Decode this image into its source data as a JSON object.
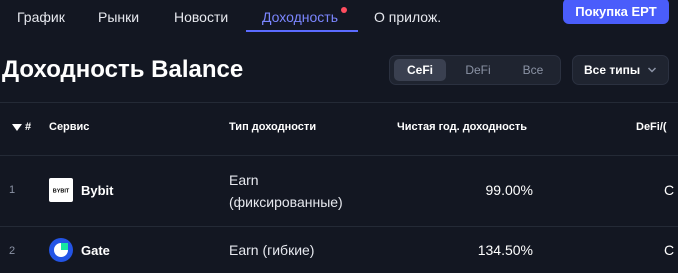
{
  "nav": {
    "items": [
      "График",
      "Рынки",
      "Новости",
      "Доходность",
      "О прилож."
    ],
    "active_index": 3,
    "buy_button": "Покупка EPT"
  },
  "page_title": "Доходность Balance",
  "segment": {
    "options": [
      "CeFi",
      "DeFi",
      "Все"
    ],
    "selected": "CeFi"
  },
  "type_filter": {
    "label": "Все типы",
    "icon": "chevron-down-icon"
  },
  "table": {
    "columns": [
      "#",
      "Сервис",
      "Тип доходности",
      "Чистая год. доходность",
      "DeFi/("
    ],
    "sort_icon": "sort-down-icon",
    "rows": [
      {
        "num": "1",
        "service": "Bybit",
        "logo_text": "BYBIT",
        "yield_type_line1": "Earn",
        "yield_type_line2": "(фиксированные)",
        "yield": "99.00%",
        "cut": "C"
      },
      {
        "num": "2",
        "service": "Gate",
        "yield_type_line1": "Earn (гибкие)",
        "yield_type_line2": "",
        "yield": "134.50%",
        "cut": "C"
      }
    ]
  },
  "colors": {
    "background": "#131722",
    "accent": "#4a5dfb",
    "active_nav": "#7b86ff",
    "notify_dot": "#ff4d5f"
  }
}
